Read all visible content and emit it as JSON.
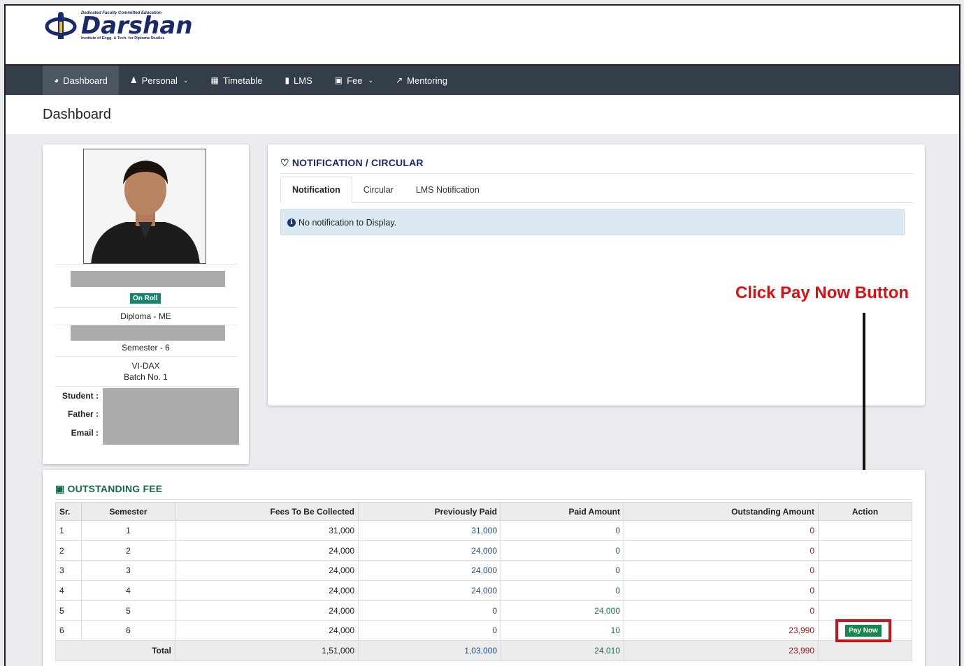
{
  "brand": {
    "tagline": "Dedicated Faculty Committed Education",
    "name": "Darshan",
    "subtitle": "Institute of Engg. & Tech. for Diploma Studies"
  },
  "nav": {
    "items": [
      {
        "label": "Dashboard",
        "icon": "dashboard-icon",
        "active": true
      },
      {
        "label": "Personal",
        "icon": "user-icon",
        "dropdown": true
      },
      {
        "label": "Timetable",
        "icon": "calendar-icon"
      },
      {
        "label": "LMS",
        "icon": "book-icon"
      },
      {
        "label": "Fee",
        "icon": "money-icon",
        "dropdown": true
      },
      {
        "label": "Mentoring",
        "icon": "chart-line-icon"
      }
    ]
  },
  "page": {
    "title": "Dashboard"
  },
  "profile": {
    "status_badge": "On Roll",
    "program": "Diploma - ME",
    "semester": "Semester - 6",
    "division": "VI-DAX",
    "batch": "Batch No. 1",
    "labels": {
      "student": "Student :",
      "father": "Father :",
      "email": "Email :"
    }
  },
  "notification": {
    "heading": "NOTIFICATION / CIRCULAR",
    "tabs": [
      "Notification",
      "Circular",
      "LMS Notification"
    ],
    "active_tab": "Notification",
    "message": "No notification to Display."
  },
  "annotation": {
    "instruction": "Click Pay Now Button",
    "color": "#dd1010"
  },
  "fee": {
    "heading": "OUTSTANDING FEE",
    "columns": [
      "Sr.",
      "Semester",
      "Fees To Be Collected",
      "Previously Paid",
      "Paid Amount",
      "Outstanding Amount",
      "Action"
    ],
    "rows": [
      {
        "sr": "1",
        "semester": "1",
        "fees": "31,000",
        "previously_paid": "31,000",
        "paid_amount": "0",
        "outstanding": "0"
      },
      {
        "sr": "2",
        "semester": "2",
        "fees": "24,000",
        "previously_paid": "24,000",
        "paid_amount": "0",
        "outstanding": "0"
      },
      {
        "sr": "3",
        "semester": "3",
        "fees": "24,000",
        "previously_paid": "24,000",
        "paid_amount": "0",
        "outstanding": "0"
      },
      {
        "sr": "4",
        "semester": "4",
        "fees": "24,000",
        "previously_paid": "24,000",
        "paid_amount": "0",
        "outstanding": "0"
      },
      {
        "sr": "5",
        "semester": "5",
        "fees": "24,000",
        "previously_paid": "0",
        "paid_amount": "24,000",
        "outstanding": "0"
      },
      {
        "sr": "6",
        "semester": "6",
        "fees": "24,000",
        "previously_paid": "0",
        "paid_amount": "10",
        "outstanding": "23,990"
      }
    ],
    "total": {
      "label": "Total",
      "fees": "1,51,000",
      "previously_paid": "1,03,000",
      "paid_amount": "24,010",
      "outstanding": "23,990"
    },
    "pay_button": "Pay Now"
  }
}
